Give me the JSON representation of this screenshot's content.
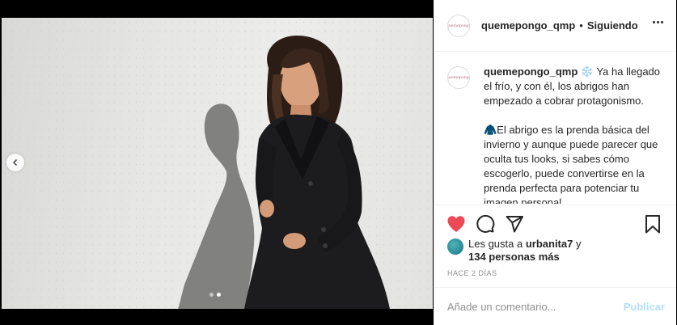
{
  "post": {
    "carousel": {
      "slide_count": 2,
      "active_slide": 2
    }
  },
  "header": {
    "avatar_text": "quemepongo",
    "username": "quemepongo_qmp",
    "separator": "•",
    "follow_status": "Siguiendo"
  },
  "caption": {
    "avatar_text": "quemepongo",
    "username": "quemepongo_qmp",
    "paragraph1": " ❄️ Ya ha llegado el frío, y con él, los abrigos han empezado a cobrar protagonismo.",
    "paragraph2": "🧥El abrigo es la prenda básica del invierno y aunque puede parecer que oculta tus looks, si sabes cómo escogerlo, puede convertirse en la prenda perfecta para potenciar tu imagen personal."
  },
  "actions": {
    "like_icon": "heart-filled-icon",
    "comment_icon": "comment-icon",
    "share_icon": "paper-plane-icon",
    "save_icon": "bookmark-icon",
    "like_color": "#ed4956"
  },
  "likes": {
    "prefix": "Les gusta a ",
    "first_user": "urbanita7",
    "conj": " y",
    "others": "134 personas más"
  },
  "timestamp": "HACE 2 DÍAS",
  "comment": {
    "placeholder": "Añade un comentario...",
    "publish_label": "Publicar"
  }
}
